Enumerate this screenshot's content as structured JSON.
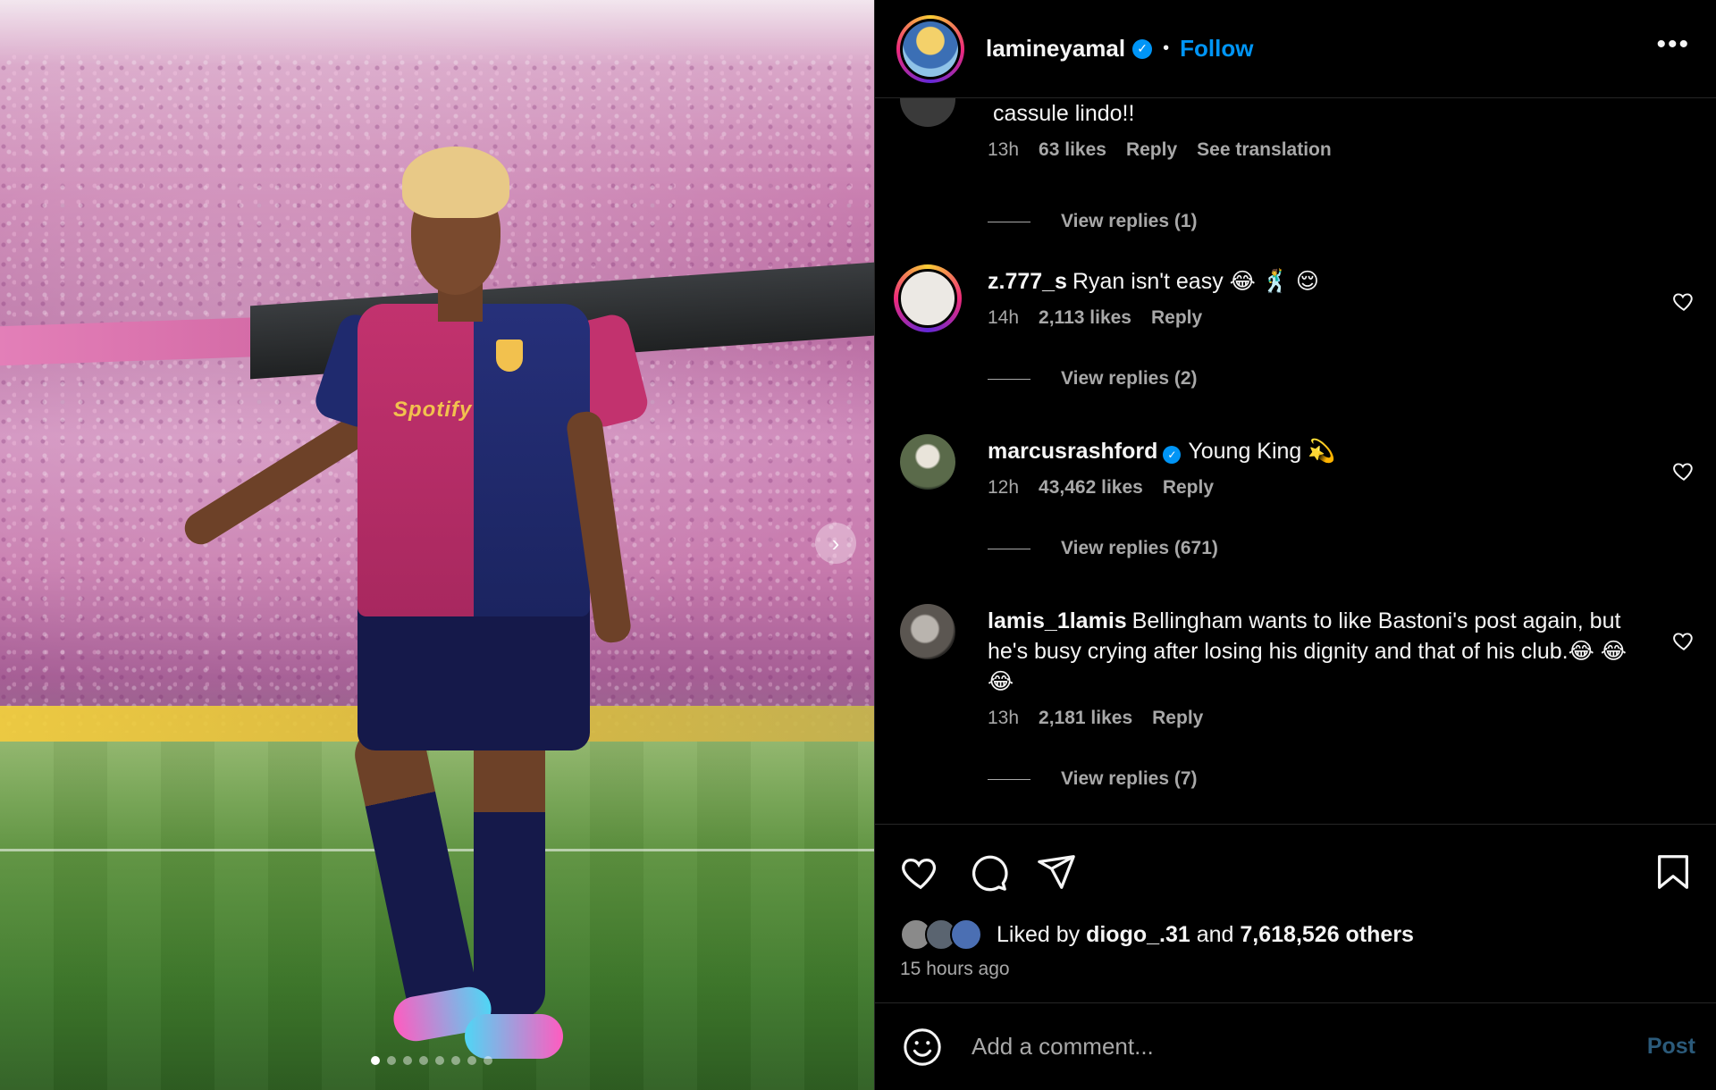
{
  "colors": {
    "accent": "#0095f6",
    "background": "#000000",
    "text": "#f5f5f5",
    "muted": "#a8a8a8",
    "post_disabled": "#2b5a7a"
  },
  "media": {
    "carousel_dot_count": 8,
    "active_dot_index": 0,
    "next_icon": "chevron-right-icon",
    "jersey_sponsor": "Spotify"
  },
  "header": {
    "username": "lamineyamal",
    "verified_icon": "verified-badge-icon",
    "separator": "•",
    "follow_label": "Follow",
    "more_icon": "more-options-icon",
    "more_glyph": "•••"
  },
  "comments": [
    {
      "user": "",
      "text": "cassule lindo!!",
      "time": "13h",
      "likes": "63 likes",
      "reply": "Reply",
      "extra": "See translation",
      "replies": "View replies (1)"
    },
    {
      "user": "z.777_s",
      "text": "Ryan isn't easy 😂 🕺 😌",
      "time": "14h",
      "likes": "2,113 likes",
      "reply": "Reply",
      "replies": "View replies (2)"
    },
    {
      "user": "marcusrashford",
      "text": "Young King 💫",
      "time": "12h",
      "likes": "43,462 likes",
      "reply": "Reply",
      "replies": "View replies (671)"
    },
    {
      "user": "lamis_1lamis",
      "text": "Bellingham wants to like Bastoni's post again, but he's busy crying after losing his dignity and that of his club.😂 😂 😂",
      "time": "13h",
      "likes": "2,181 likes",
      "reply": "Reply",
      "replies": "View replies (7)"
    }
  ],
  "actions": {
    "like_icon": "heart-icon",
    "comment_icon": "comment-icon",
    "share_icon": "share-icon",
    "save_icon": "bookmark-icon"
  },
  "likes": {
    "prefix": "Liked by",
    "user": "diogo_.31",
    "and": "and",
    "others": "7,618,526 others",
    "time_ago": "15 hours ago"
  },
  "composer": {
    "emoji_icon": "emoji-icon",
    "placeholder": "Add a comment...",
    "post_label": "Post"
  }
}
